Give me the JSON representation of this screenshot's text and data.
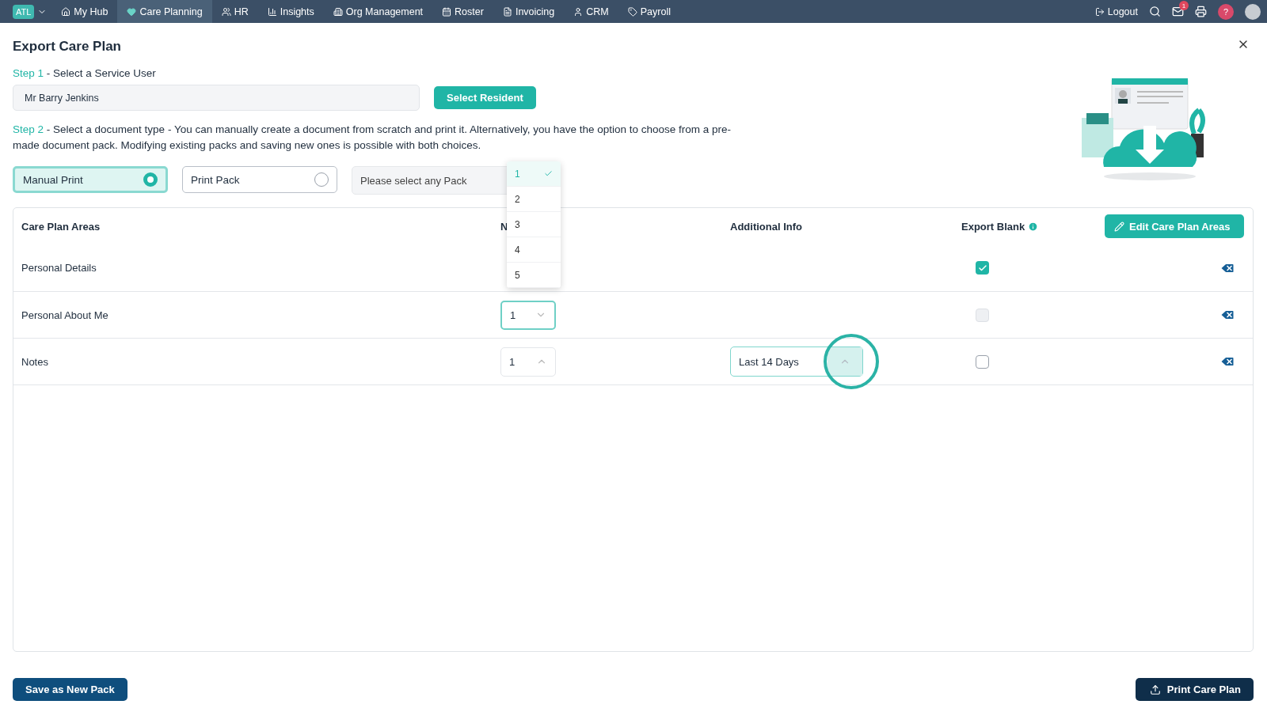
{
  "nav": {
    "org_badge": "ATL",
    "items": [
      {
        "label": "My Hub",
        "selected": false
      },
      {
        "label": "Care Planning",
        "selected": true
      },
      {
        "label": "HR",
        "selected": false
      },
      {
        "label": "Insights",
        "selected": false
      },
      {
        "label": "Org Management",
        "selected": false
      },
      {
        "label": "Roster",
        "selected": false
      },
      {
        "label": "Invoicing",
        "selected": false
      },
      {
        "label": "CRM",
        "selected": false
      },
      {
        "label": "Payroll",
        "selected": false
      }
    ],
    "logout": "Logout",
    "mail_count": "1",
    "help": "?"
  },
  "dialog": {
    "title": "Export Care Plan",
    "step1": {
      "label": "Step 1",
      "text": "- Select a Service User",
      "value": "Mr Barry Jenkins",
      "button": "Select Resident"
    },
    "step2": {
      "label": "Step 2",
      "text": "- Select a document type",
      "description": "- You can manually create a document from scratch and print it. Alternatively, you have the option to choose from a pre-made document pack. Modifying existing packs and saving new ones is possible with both choices."
    },
    "options": [
      {
        "label": "Manual Print",
        "selected": true
      },
      {
        "label": "Print Pack",
        "selected": false
      }
    ],
    "pack_select": {
      "placeholder": "Please select any Pack"
    },
    "dropdown": {
      "options": [
        {
          "label": "1",
          "selected": true
        },
        {
          "label": "2",
          "selected": false
        },
        {
          "label": "3",
          "selected": false
        },
        {
          "label": "4",
          "selected": false
        },
        {
          "label": "5",
          "selected": false
        }
      ]
    },
    "table": {
      "columns": [
        "Care Plan Areas",
        "N",
        "Additional Info",
        "Export Blank"
      ],
      "edit_button": "Edit Care Plan Areas",
      "rows": [
        {
          "area": "Personal Details",
          "number": null,
          "additional": null,
          "export_blank": {
            "checked": true,
            "disabled": false
          }
        },
        {
          "area": "Personal About Me",
          "number": {
            "value": "1",
            "expanded": false,
            "focused": true
          },
          "additional": null,
          "export_blank": {
            "checked": false,
            "disabled": true
          }
        },
        {
          "area": "Notes",
          "number": {
            "value": "1",
            "expanded": true,
            "focused": false
          },
          "additional": {
            "value": "Last 14 Days",
            "highlighted": true
          },
          "export_blank": {
            "checked": false,
            "disabled": false
          }
        }
      ]
    },
    "footer": {
      "save": "Save as New Pack",
      "print": "Print Care Plan"
    }
  }
}
